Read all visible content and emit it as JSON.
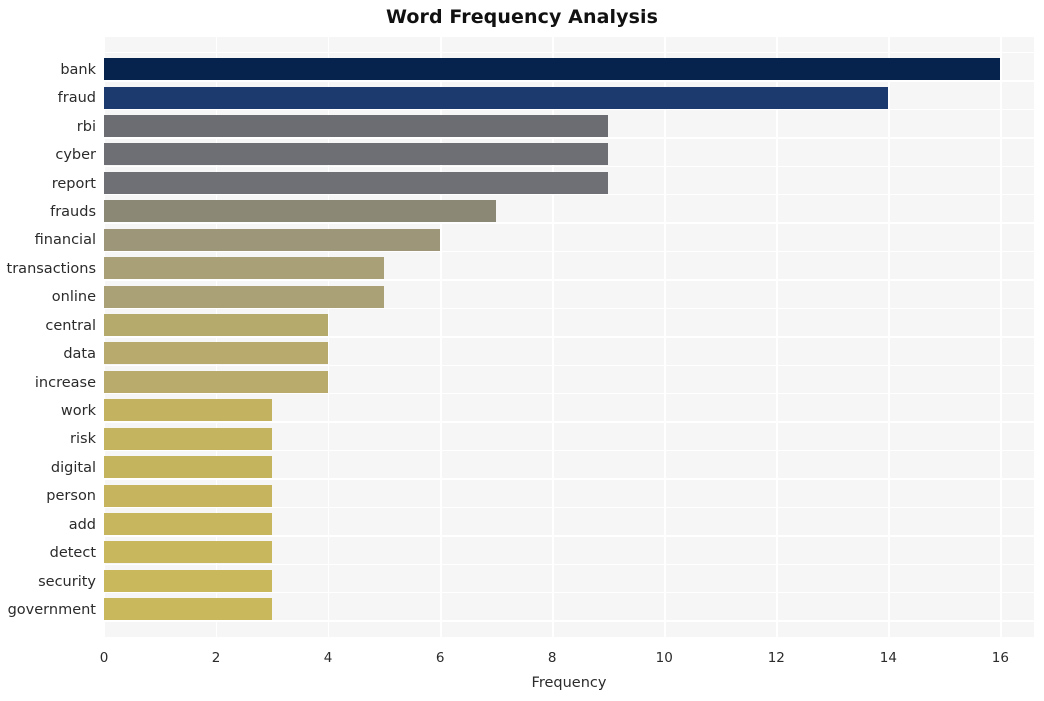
{
  "chart_data": {
    "type": "bar",
    "orientation": "horizontal",
    "title": "Word Frequency Analysis",
    "xlabel": "Frequency",
    "ylabel": "",
    "xlim": [
      0,
      16.6
    ],
    "ylim": null,
    "grid": true,
    "legend": null,
    "xticks": [
      0,
      2,
      4,
      6,
      8,
      10,
      12,
      14,
      16
    ],
    "xtick_labels": [
      "0",
      "2",
      "4",
      "6",
      "8",
      "10",
      "12",
      "14",
      "16"
    ],
    "categories": [
      "bank",
      "fraud",
      "rbi",
      "cyber",
      "report",
      "frauds",
      "financial",
      "transactions",
      "online",
      "central",
      "data",
      "increase",
      "work",
      "risk",
      "digital",
      "person",
      "add",
      "detect",
      "security",
      "government"
    ],
    "values": [
      16,
      14,
      9,
      9,
      9,
      7,
      6,
      5,
      5,
      4,
      4,
      4,
      3,
      3,
      3,
      3,
      3,
      3,
      3,
      3
    ],
    "bar_colors": [
      "#05234d",
      "#1d3a6e",
      "#6c6d72",
      "#6e6f74",
      "#6f7075",
      "#8b8875",
      "#9d9678",
      "#aaa077",
      "#aba177",
      "#b6a96c",
      "#b7aa6c",
      "#b8ab6c",
      "#c3b25f",
      "#c4b35f",
      "#c5b45e",
      "#c6b55e",
      "#c7b65d",
      "#c8b75d",
      "#c9b85c",
      "#c9b85c"
    ]
  },
  "style": {
    "figure_background": "#ffffff",
    "plot_background": "#f6f6f7",
    "gridline_color": "#ffffff",
    "text_color": "#2b2b2b",
    "title_color": "#111111"
  }
}
